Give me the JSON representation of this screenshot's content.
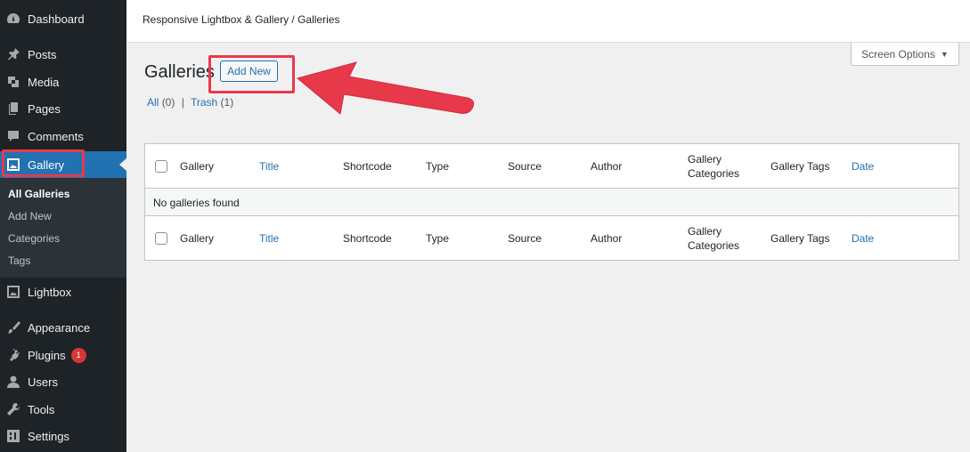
{
  "sidebar": {
    "items": [
      {
        "label": "Dashboard",
        "icon": "dashboard-icon"
      },
      {
        "label": "Posts",
        "icon": "pin-icon"
      },
      {
        "label": "Media",
        "icon": "media-icon"
      },
      {
        "label": "Pages",
        "icon": "pages-icon"
      },
      {
        "label": "Comments",
        "icon": "comment-icon"
      },
      {
        "label": "Gallery",
        "icon": "gallery-icon"
      },
      {
        "label": "Lightbox",
        "icon": "lightbox-icon"
      },
      {
        "label": "Appearance",
        "icon": "brush-icon"
      },
      {
        "label": "Plugins",
        "icon": "plug-icon",
        "badge": "1"
      },
      {
        "label": "Users",
        "icon": "user-icon"
      },
      {
        "label": "Tools",
        "icon": "wrench-icon"
      },
      {
        "label": "Settings",
        "icon": "settings-icon"
      }
    ],
    "submenu": [
      "All Galleries",
      "Add New",
      "Categories",
      "Tags"
    ]
  },
  "header": {
    "breadcrumb": "Responsive Lightbox & Gallery / Galleries",
    "screen_options": "Screen Options"
  },
  "main": {
    "title": "Galleries",
    "add_new": "Add New",
    "filters": {
      "all_label": "All",
      "all_count": "(0)",
      "separator": "|",
      "trash_label": "Trash",
      "trash_count": "(1)"
    },
    "table": {
      "columns": [
        "Gallery",
        "Title",
        "Shortcode",
        "Type",
        "Source",
        "Author",
        "Gallery Categories",
        "Gallery Tags",
        "Date"
      ],
      "empty_message": "No galleries found"
    }
  },
  "colors": {
    "sidebar_bg": "#1d2327",
    "active_bg": "#2271b1",
    "link": "#2271b1",
    "highlight": "#e8394a",
    "badge": "#d63638"
  }
}
